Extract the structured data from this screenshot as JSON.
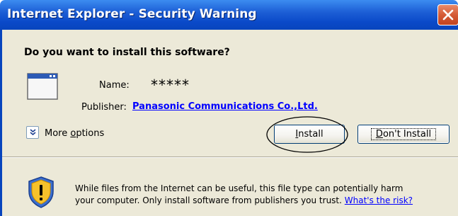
{
  "window": {
    "title": "Internet Explorer - Security Warning"
  },
  "question": "Do you want to install this software?",
  "details": {
    "name_label": "Name:",
    "name_value": "*****",
    "publisher_label": "Publisher:",
    "publisher_value": "Panasonic Communications Co.,Ltd."
  },
  "more_options": {
    "label_prefix": "More ",
    "label_mnemonic": "o",
    "label_suffix": "ptions"
  },
  "buttons": {
    "install_mnemonic": "I",
    "install_rest": "nstall",
    "dont_mnemonic": "D",
    "dont_rest": "on't Install"
  },
  "warning": {
    "line1": "While files from the Internet can be useful, this file type can potentially harm",
    "line2": "your computer. Only install software from publishers you trust.",
    "link": "What's the risk?"
  },
  "icons": {
    "app": "application-window-icon",
    "shield": "security-shield-warning-icon",
    "close": "close-icon",
    "expand": "chevron-down-double-icon"
  },
  "colors": {
    "titlebar": "#0a49c8",
    "body": "#ece9d8",
    "link": "#0000ff",
    "close": "#d55b37"
  }
}
